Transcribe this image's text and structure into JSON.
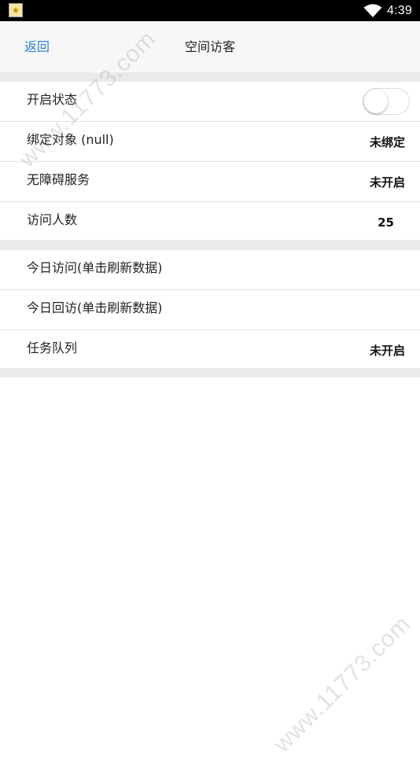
{
  "status_bar": {
    "time": "4:39",
    "app_icon": "app-star-icon",
    "wifi_icon": "wifi-icon"
  },
  "header": {
    "back_label": "返回",
    "title": "空间访客"
  },
  "sections": [
    {
      "rows": [
        {
          "label": "开启状态",
          "type": "toggle",
          "on": false
        },
        {
          "label": "绑定对象 (null)",
          "value": "未绑定"
        },
        {
          "label": "无障碍服务",
          "value": "未开启"
        },
        {
          "label": "访问人数",
          "value": "25"
        }
      ]
    },
    {
      "rows": [
        {
          "label": "今日访问(单击刷新数据)"
        },
        {
          "label": "今日回访(单击刷新数据)"
        },
        {
          "label": "任务队列",
          "value": "未开启"
        }
      ]
    }
  ],
  "watermark": "www.11773.com",
  "colors": {
    "accent": "#2a7fd6",
    "header_bg": "#f7f7f7",
    "separator_bg": "#eaeaea"
  }
}
